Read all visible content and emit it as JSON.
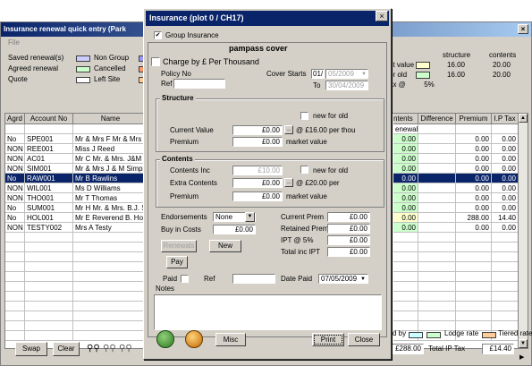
{
  "background_window": {
    "title": "Insurance renewal quick entry (Park",
    "close": "×",
    "menu_file": "File",
    "legend_left": [
      {
        "label": "Saved renewal(s)",
        "color": "#ccccff"
      },
      {
        "label": "Agreed renewal",
        "color": "#ccffcc"
      },
      {
        "label": "Quote",
        "color": "#ffffff"
      },
      {
        "label": "Non Group",
        "color": "#9999ff"
      },
      {
        "label": "Cancelled",
        "color": "#ff9966"
      },
      {
        "label": "Left Site",
        "color": "#ffcc99"
      }
    ],
    "rates": {
      "header_structure": "structure",
      "header_contents": "contents",
      "rows": [
        {
          "label": "et value",
          "color": "#ffffcc",
          "structure": "16.00",
          "contents": "20.00"
        },
        {
          "label": "or old",
          "color": "#ccffcc",
          "structure": "16.00",
          "contents": "20.00"
        },
        {
          "label": "ax @",
          "structure": "5%"
        }
      ]
    },
    "table": {
      "headers": [
        "Agrd",
        "Account No",
        "Name",
        "",
        "ntents",
        "Difference",
        "Premium",
        "I.P Tax"
      ],
      "renewal_sub": "enewal",
      "rows": [
        {
          "agrd": "No",
          "acc": "SPE001",
          "name": "Mr & Mrs F Mr & Mrs Sp",
          "cont": "0.00",
          "premium": "0.00",
          "tax": "0.00"
        },
        {
          "agrd": "NON",
          "acc": "REE001",
          "name": "Miss J Reed",
          "cont": "0.00",
          "premium": "0.00",
          "tax": "0.00"
        },
        {
          "agrd": "NON",
          "acc": "AC01",
          "name": "Mr C Mr. & Mrs. J&M Sir",
          "cont": "0.00",
          "premium": "0.00",
          "tax": "0.00"
        },
        {
          "agrd": "NON",
          "acc": "SIM001",
          "name": "Mr & Mrs J & M Simpsor",
          "cont": "0.00",
          "premium": "0.00",
          "tax": "0.00"
        },
        {
          "agrd": "No",
          "acc": "RAW001",
          "name": "Mr B Rawlins",
          "cont": "0.00",
          "premium": "0.00",
          "tax": "0.00"
        },
        {
          "agrd": "NON",
          "acc": "WIL001",
          "name": "Ms D Williams",
          "cont": "0.00",
          "premium": "0.00",
          "tax": "0.00"
        },
        {
          "agrd": "NON",
          "acc": "THO001",
          "name": "Mr T Thomas",
          "cont": "0.00",
          "premium": "0.00",
          "tax": "0.00"
        },
        {
          "agrd": "No",
          "acc": "SUM001",
          "name": "Mr H Mr. & Mrs. B.J. Su",
          "cont": "0.00",
          "premium": "0.00",
          "tax": "0.00"
        },
        {
          "agrd": "No",
          "acc": "HOL001",
          "name": "Mr E Reverend B. Holy",
          "cont": "0.00",
          "premium": "288.00",
          "tax": "14.40"
        },
        {
          "agrd": "NON",
          "acc": "TESTY002",
          "name": "Mrs A Testy",
          "cont": "0.00",
          "premium": "0.00",
          "tax": "0.00"
        }
      ]
    },
    "bottom": {
      "swap": "Swap",
      "clear": "Clear",
      "legend_d_by": "d by",
      "legend_lodge": "Lodge rate",
      "legend_tiered": "Tiered rate",
      "total": "£288.00",
      "total_ipt_label": "Total IP Tax",
      "total_ipt": "£14.40"
    }
  },
  "dialog": {
    "title": "Insurance   (plot 0 / CH17)",
    "close": "×",
    "group_insurance": "Group Insurance",
    "cover_name": "pampass cover",
    "charge_per_thousand": "Charge by £ Per Thousand",
    "policy_no": "Policy No",
    "ref": "Ref",
    "cover_starts": "Cover Starts",
    "cover_start_day": "01/",
    "cover_start_date": "05/2009",
    "to": "To",
    "cover_end": "30/04/2009",
    "structure": {
      "title": "Structure",
      "new_for_old": "new for old",
      "current_value": "Current Value",
      "current_value_val": "£0.00",
      "rate_text": "@ £16.00 per thou",
      "premium": "Premium",
      "premium_val": "£0.00",
      "market_value": "market value"
    },
    "contents": {
      "title": "Contents",
      "contents_inc": "Contents Inc",
      "contents_inc_val": "£10.00",
      "new_for_old": "new for old",
      "extra_contents": "Extra Contents",
      "extra_val": "£0.00",
      "rate_text": "@ £20.00 per",
      "premium": "Premium",
      "premium_val": "£0.00",
      "market_value": "market value"
    },
    "endorsements": "Endorsements",
    "endorse_value": "None",
    "buy_in_costs": "Buy in Costs",
    "buy_in_val": "£0.00",
    "renewals": "Renewals",
    "new": "New",
    "pay": "Pay",
    "current_prem": "Current Prem",
    "current_prem_val": "£0.00",
    "retained_prem": "Retained Prem",
    "retained_prem_val": "£0.00",
    "ipt": "IPT @ 5%",
    "ipt_val": "£0.00",
    "total_inc_ipt": "Total inc IPT",
    "total_inc_ipt_val": "£0.00",
    "paid": "Paid",
    "ref2": "Ref",
    "date_paid": "Date Paid",
    "date_paid_val": "07/05/2009",
    "notes": "Notes",
    "misc": "Misc",
    "print": "Print",
    "close_btn": "Close"
  }
}
